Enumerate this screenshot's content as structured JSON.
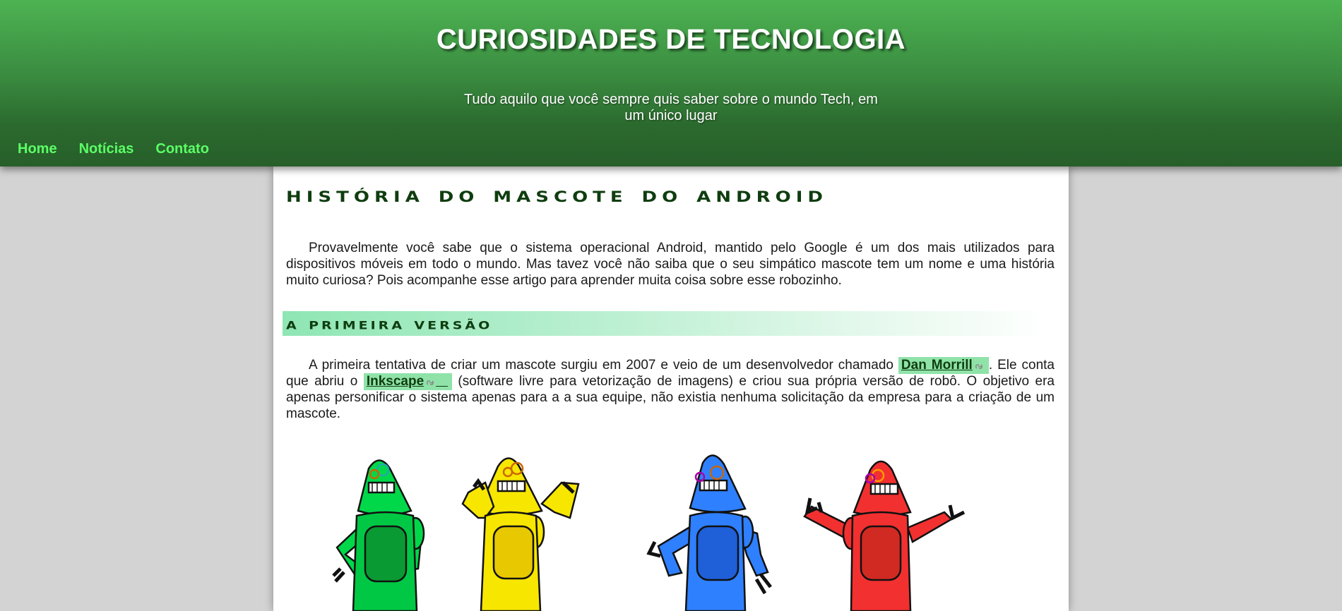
{
  "header": {
    "title": "CURIOSIDADES DE TECNOLOGIA",
    "subtitle": "Tudo aquilo que você sempre quis saber sobre o mundo Tech, em um único lugar"
  },
  "nav": {
    "home": "Home",
    "noticias": "Notícias",
    "contato": "Contato"
  },
  "article": {
    "title": "HISTÓRIA DO MASCOTE DO ANDROID",
    "intro": "Provavelmente você sabe que o sistema operacional Android, mantido pelo Google é um dos mais utilizados para dispositivos móveis em todo o mundo. Mas tavez você não saiba que o seu simpático mascote tem um nome e uma história muito curiosa? Pois acompanhe esse artigo para aprender muita coisa sobre esse robozinho.",
    "section1": {
      "heading": "A PRIMEIRA VERSÃO",
      "p_start": "A primeira tentativa de criar um mascote surgiu em 2007 e veio de um desenvolvedor chamado ",
      "link1": "Dan Morrill",
      "p_mid": ". Ele conta que abriu o ",
      "link2": "Inkscape",
      "p_end": " (software livre para vetorização de imagens) e criou sua própria versão de robô. O objetivo era apenas personificar o sistema apenas para a a sua equipe, não existia nenhuma solicitação da empresa para a criação de um mascote."
    }
  },
  "colors": {
    "header_top": "#4db352",
    "header_bottom": "#275f2a",
    "nav_link": "#5cff66",
    "heading": "#0f3d0f",
    "highlight": "#8fe3a9",
    "robot_green": "#00d84a",
    "robot_yellow": "#f7e600",
    "robot_blue": "#2f80ff",
    "robot_red": "#f23030"
  }
}
